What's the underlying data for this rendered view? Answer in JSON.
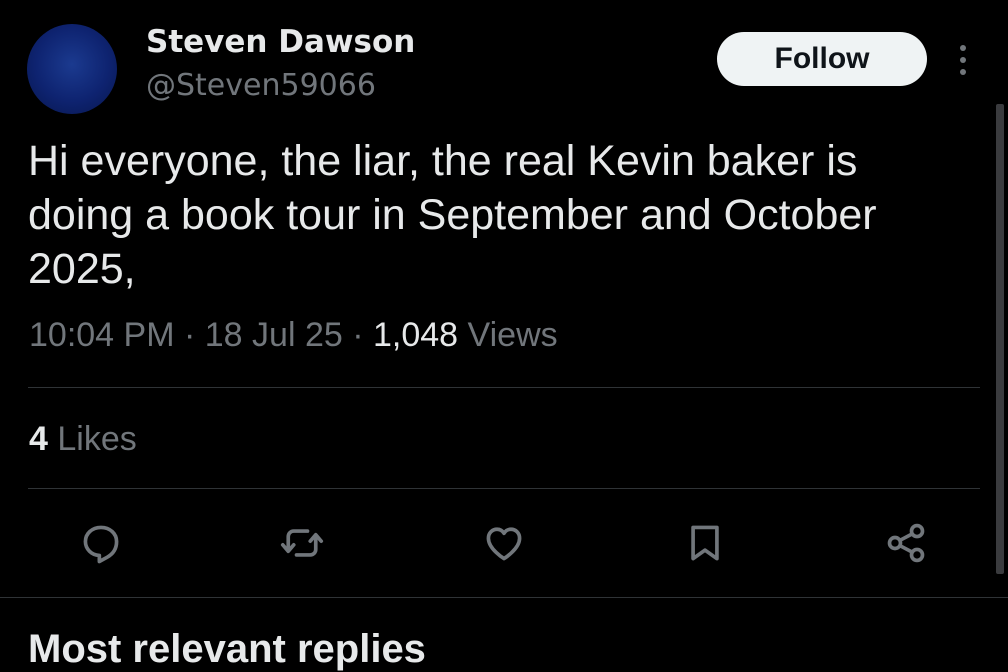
{
  "author": {
    "display_name": "Steven Dawson",
    "handle": "@Steven59066",
    "avatar_color": "#0e2370"
  },
  "follow_label": "Follow",
  "tweet": {
    "text": "Hi everyone,  the liar,  the real Kevin baker is doing a book tour in September and October 2025,",
    "time": "10:04 PM",
    "date": "18 Jul 25",
    "separator": "·",
    "views_count": "1,048",
    "views_label": "Views"
  },
  "engagement": {
    "likes_count": "4",
    "likes_label": "Likes"
  },
  "actions": [
    {
      "icon": "reply-icon"
    },
    {
      "icon": "retweet-icon"
    },
    {
      "icon": "like-icon"
    },
    {
      "icon": "bookmark-icon"
    },
    {
      "icon": "share-icon"
    }
  ],
  "next_section_heading": "Most relevant replies",
  "colors": {
    "background": "#000000",
    "text_primary": "#e7e9ea",
    "text_secondary": "#71767b",
    "divider": "#2f3336",
    "button_bg": "#eff3f4"
  }
}
